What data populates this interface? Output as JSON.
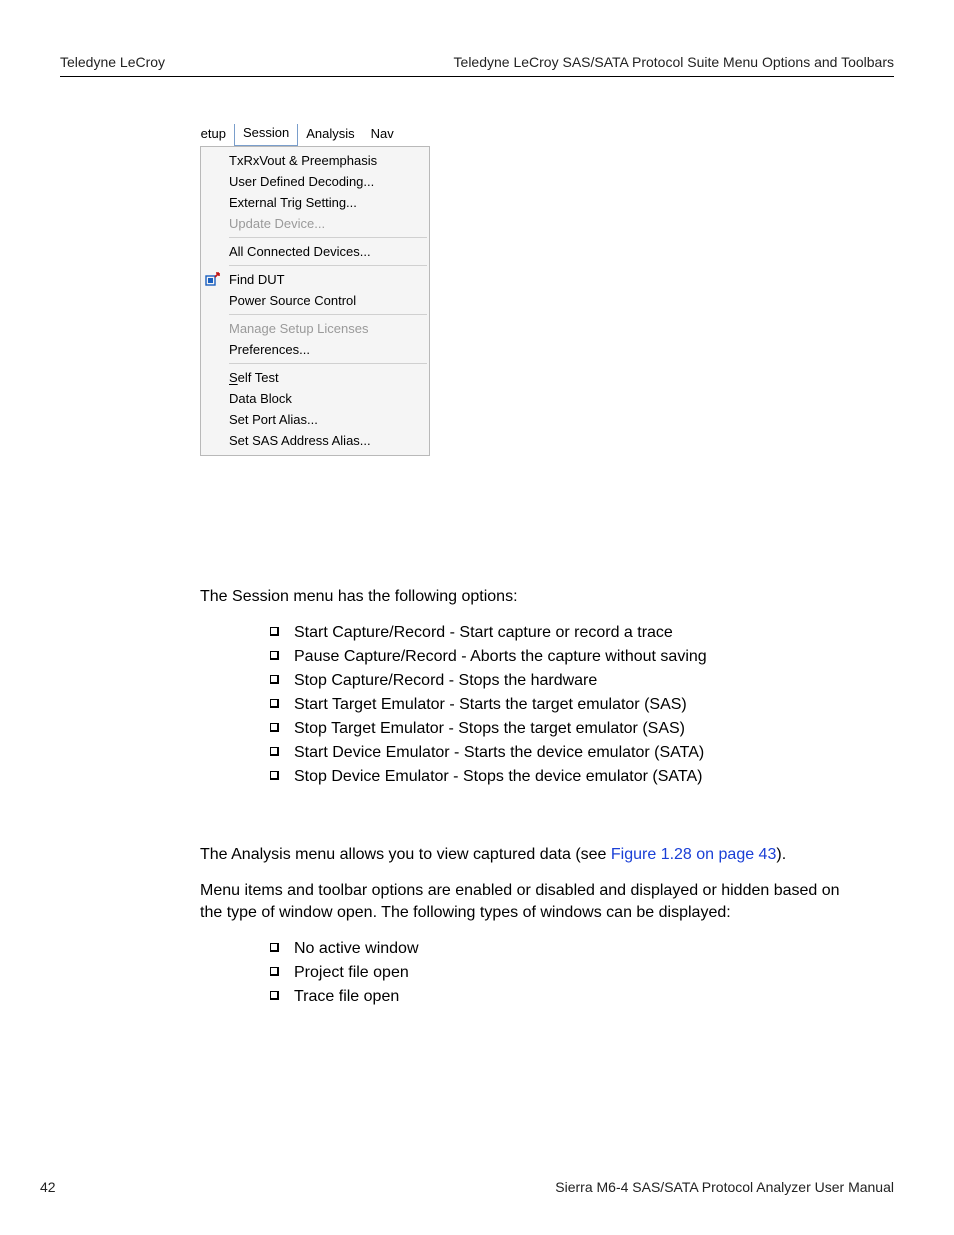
{
  "header": {
    "left": "Teledyne LeCroy",
    "right": "Teledyne LeCroy SAS/SATA Protocol Suite Menu Options and Toolbars"
  },
  "screenshot": {
    "menubar": {
      "setup_clipped": "Setup",
      "session": "Session",
      "analysis": "Analysis",
      "nav_clipped": "Nav"
    },
    "groups": [
      {
        "items": [
          {
            "label": "TxRxVout & Preemphasis",
            "disabled": false
          },
          {
            "label": "User Defined Decoding...",
            "disabled": false
          },
          {
            "label": "External Trig Setting...",
            "disabled": false
          },
          {
            "label": "Update Device...",
            "disabled": true
          }
        ]
      },
      {
        "items": [
          {
            "label": "All Connected Devices...",
            "disabled": false
          }
        ]
      },
      {
        "items": [
          {
            "label": "Find DUT",
            "disabled": false,
            "icon": "find-dut"
          },
          {
            "label": "Power Source Control",
            "disabled": false
          }
        ]
      },
      {
        "items": [
          {
            "label": "Manage Setup Licenses",
            "disabled": true
          },
          {
            "label": "Preferences...",
            "disabled": false
          }
        ]
      },
      {
        "items": [
          {
            "label_html": "self_test",
            "label": "Self Test",
            "disabled": false
          },
          {
            "label": "Data Block",
            "disabled": false
          },
          {
            "label": "Set Port Alias...",
            "disabled": false
          },
          {
            "label": "Set SAS Address Alias...",
            "disabled": false
          }
        ]
      }
    ]
  },
  "body": {
    "p1": "The Session menu has the following options:",
    "list1": [
      "Start Capture/Record - Start capture or record a trace",
      "Pause Capture/Record - Aborts the capture without saving",
      "Stop Capture/Record - Stops the hardware",
      "Start Target Emulator - Starts the target emulator (SAS)",
      "Stop Target Emulator - Stops the target emulator (SAS)",
      "Start Device Emulator - Starts the device emulator (SATA)",
      "Stop Device Emulator - Stops the device emulator (SATA)"
    ],
    "p2_pre": "The Analysis menu allows you to view captured data (see ",
    "p2_link": "Figure 1.28 on page 43",
    "p2_post": ").",
    "p3": "Menu items and toolbar options are enabled or disabled and displayed or hidden based on the type of window open. The following types of windows can be displayed:",
    "list2": [
      "No active window",
      "Project file open",
      "Trace file open"
    ]
  },
  "footer": {
    "page": "42",
    "title": "Sierra M6-4 SAS/SATA Protocol Analyzer User Manual"
  }
}
